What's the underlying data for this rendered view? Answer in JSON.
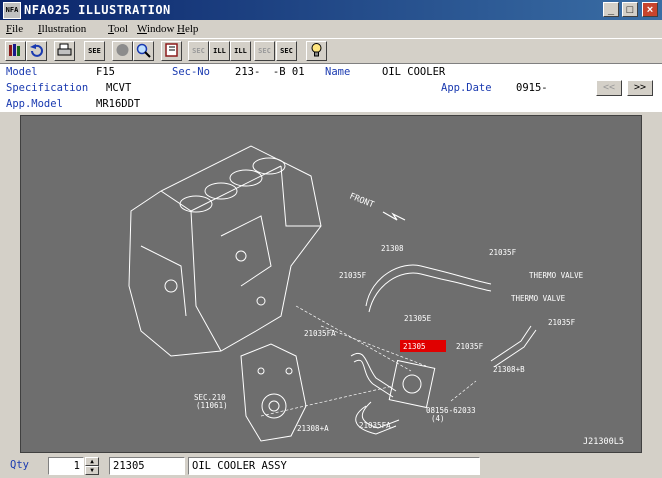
{
  "window": {
    "app_icon_text": "NFA",
    "title": "NFA025  ILLUSTRATION",
    "minimize_glyph": "_",
    "maximize_glyph": "□",
    "close_glyph": "×"
  },
  "menu": [
    {
      "key": "F",
      "rest": "ile"
    },
    {
      "key": "I",
      "rest": "llustration"
    },
    {
      "key": "T",
      "rest": "ool"
    },
    {
      "key": "W",
      "rest": "indow"
    },
    {
      "key": "H",
      "rest": "elp"
    }
  ],
  "toolbar": {
    "sec_label_1": "SEE",
    "sec_label_2": "SEC",
    "ill_label_1": "ILL",
    "ill_label_2": "ILL",
    "sec_label_3": "SEC",
    "sec_label_4": "SEC"
  },
  "info": {
    "model_label": "Model",
    "model_value": "F15",
    "secno_label": "Sec-No",
    "secno_value": "213-  -B 01",
    "name_label": "Name",
    "name_value": "OIL COOLER",
    "spec_label": "Specification",
    "spec_value": "MCVT",
    "appdate_label": "App.Date",
    "appdate_value": "0915-",
    "appmodel_label": "App.Model",
    "appmodel_value": "MR16DDT",
    "prev_label": "<<",
    "next_label": ">>"
  },
  "illustration": {
    "front_label": "FRONT",
    "callouts": {
      "c21308": "21308",
      "c21035f_a": "21035F",
      "c21035f_b": "21035F",
      "c21035f_c": "21035F",
      "c21035f_d": "21035F",
      "thermo_a": "THERMO VALVE",
      "thermo_b": "THERMO VALVE",
      "c21305e": "21305E",
      "c21035fa_a": "21035FA",
      "c21035fa_b": "21035FA",
      "c21305": "21305",
      "c21308b": "21308+B",
      "sec210": "SEC.210",
      "sec210_sub": "(11061)",
      "c21308a": "21308+A",
      "bolt": "08156-62033",
      "bolt_qty": "(4)",
      "drawing_id": "J21300L5"
    },
    "highlight_color": "#e00000"
  },
  "status": {
    "qty_label": "Qty",
    "qty_value": "1",
    "part_no": "21305",
    "part_name": "OIL COOLER ASSY"
  }
}
